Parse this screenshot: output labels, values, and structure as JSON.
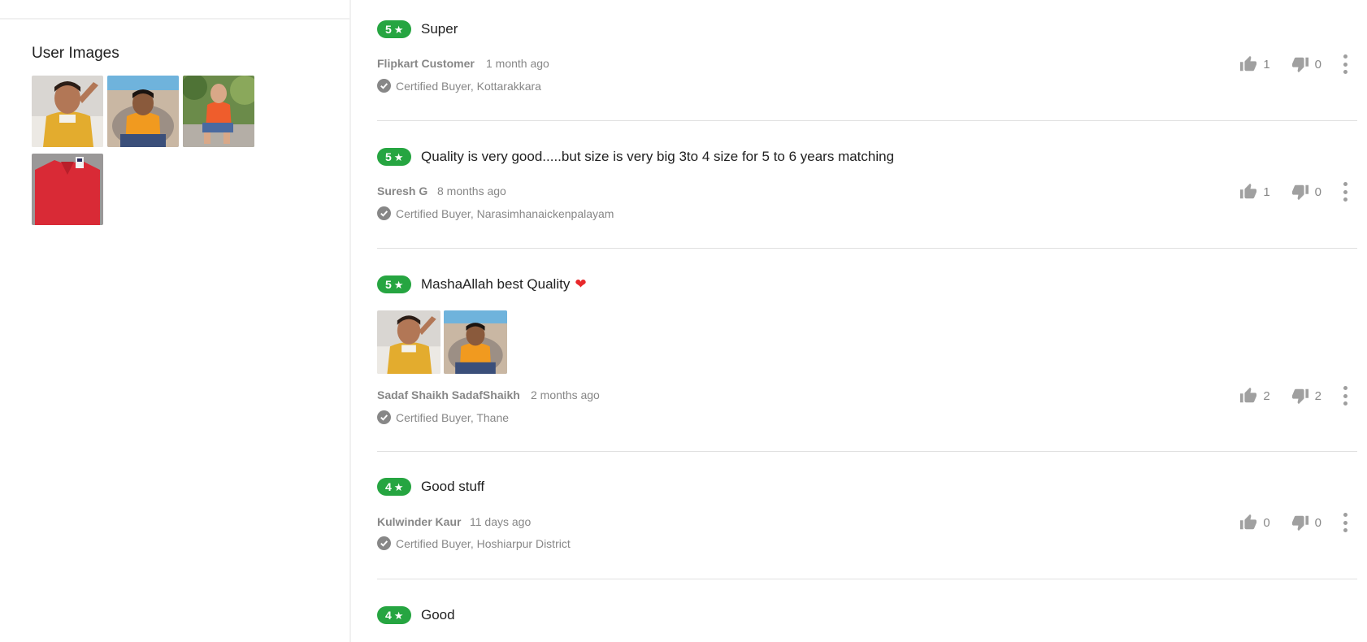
{
  "user_images": {
    "title": "User Images",
    "images": [
      "yellow-shirt-boy-photo",
      "orange-shirt-boy-chair-photo",
      "orange-shirt-boy-sitting-photo",
      "red-shirt-photo"
    ]
  },
  "colors": {
    "rating_green": "#26a541",
    "muted_text": "#878787",
    "heart_red": "#e8282b"
  },
  "reviews": [
    {
      "rating": "5",
      "title": "Super",
      "author": "Flipkart Customer",
      "time": "1 month ago",
      "certified": "Certified Buyer, Kottarakkara",
      "likes": "1",
      "dislikes": "0"
    },
    {
      "rating": "5",
      "title": "Quality is very good.....but size is very big 3to 4 size for 5 to 6 years matching",
      "author": "Suresh G",
      "time": "8 months ago",
      "certified": "Certified Buyer, Narasimhanaickenpalayam",
      "likes": "1",
      "dislikes": "0"
    },
    {
      "rating": "5",
      "title": "MashaAllah best Quality",
      "author": "Sadaf Shaikh SadafShaikh",
      "time": "2 months ago",
      "certified": "Certified Buyer, Thane",
      "likes": "2",
      "dislikes": "2",
      "images": [
        "yellow-shirt-boy-photo",
        "orange-shirt-boy-chair-photo"
      ]
    },
    {
      "rating": "4",
      "title": "Good stuff",
      "author": "Kulwinder Kaur",
      "time": "11 days ago",
      "certified": "Certified Buyer, Hoshiarpur District",
      "likes": "0",
      "dislikes": "0"
    },
    {
      "rating": "4",
      "title": "Good"
    }
  ],
  "icons": {
    "star": "★",
    "heart": "❤"
  }
}
